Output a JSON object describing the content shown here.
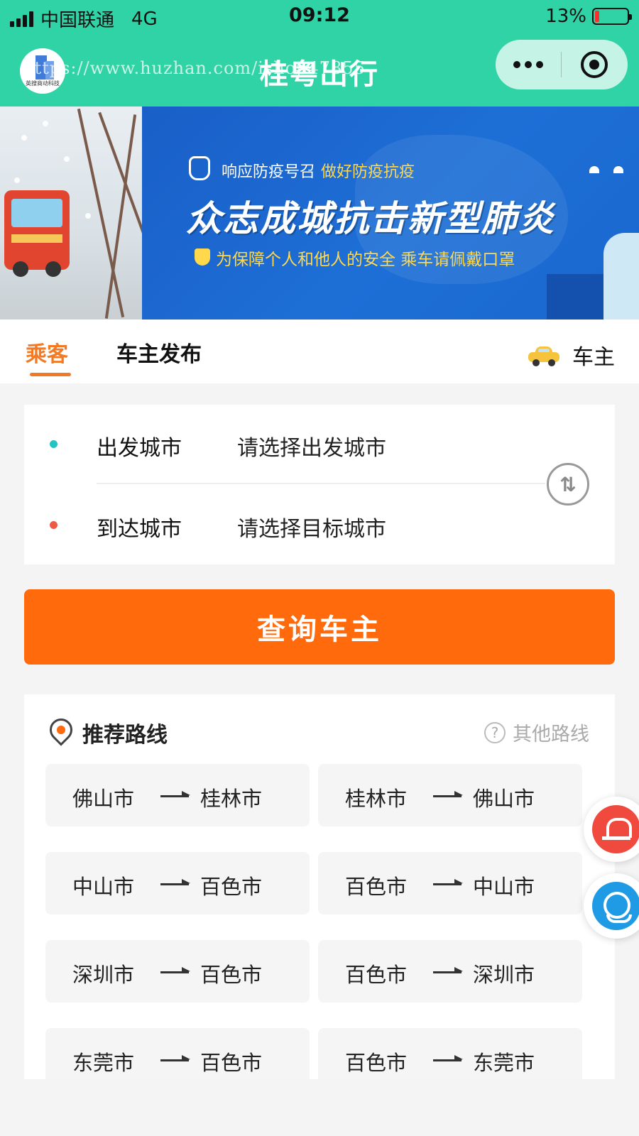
{
  "status_bar": {
    "carrier": "中国联通",
    "network": "4G",
    "time": "09:12",
    "battery": "13%",
    "battery_level": 0.13,
    "battery_color": "#ff2d2d"
  },
  "nav": {
    "title": "桂粤出行",
    "watermark": "https://www.huzhan.com/ishop47855",
    "logo_text": "英搜商动科技",
    "more_icon": "more-dots-icon",
    "close_icon": "target-close-icon",
    "bg_color": "#2fd3a5"
  },
  "banner": {
    "line1": "响应防疫号召",
    "line1_highlight": "做好防疫抗疫",
    "title": "众志成城抗击新型肺炎",
    "line2": "为保障个人和他人的安全 乘车请佩戴口罩"
  },
  "tabs": {
    "passenger": "乘客",
    "publish": "车主发布",
    "owner": "车主",
    "active_color": "#f27a25"
  },
  "city_form": {
    "from_label": "出发城市",
    "from_placeholder": "请选择出发城市",
    "to_label": "到达城市",
    "to_placeholder": "请选择目标城市",
    "swap_icon": "swap-icon"
  },
  "search_button": {
    "label": "查询车主",
    "color": "#ff6a0d"
  },
  "routes": {
    "title": "推荐路线",
    "other": "其他路线",
    "items": [
      {
        "from": "佛山市",
        "to": "桂林市"
      },
      {
        "from": "桂林市",
        "to": "佛山市"
      },
      {
        "from": "中山市",
        "to": "百色市"
      },
      {
        "from": "百色市",
        "to": "中山市"
      },
      {
        "from": "深圳市",
        "to": "百色市"
      },
      {
        "from": "百色市",
        "to": "深圳市"
      },
      {
        "from": "东莞市",
        "to": "百色市"
      },
      {
        "from": "百色市",
        "to": "东莞市"
      }
    ]
  },
  "floating": {
    "alarm_icon": "alarm-icon",
    "service_icon": "customer-service-icon"
  }
}
